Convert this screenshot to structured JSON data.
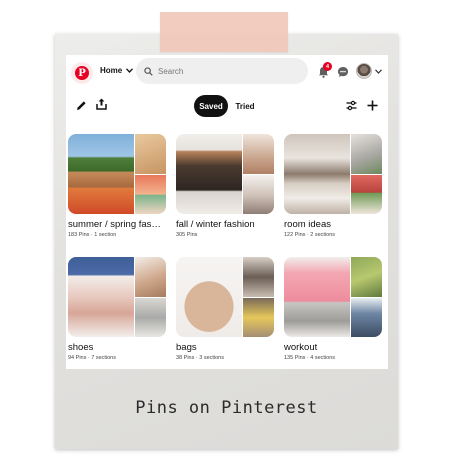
{
  "header": {
    "logo": "pinterest-logo",
    "home_label": "Home",
    "search_placeholder": "Search",
    "notification_count": "4",
    "accent_color": "#e60023"
  },
  "toolbar": {
    "tabs": [
      {
        "label": "Saved",
        "active": true
      },
      {
        "label": "Tried",
        "active": false
      }
    ],
    "icons": [
      "pencil-icon",
      "share-icon",
      "filter-icon",
      "plus-icon"
    ]
  },
  "boards": [
    {
      "title": "summer / spring fashi...",
      "meta": "183 Pins · 1 section"
    },
    {
      "title": "fall / winter fashion",
      "meta": "305 Pins"
    },
    {
      "title": "room ideas",
      "meta": "122 Pins · 2 sections"
    },
    {
      "title": "shoes",
      "meta": "94 Pins · 7 sections"
    },
    {
      "title": "bags",
      "meta": "38 Pins · 3 sections"
    },
    {
      "title": "workout",
      "meta": "135 Pins · 4 sections"
    }
  ],
  "caption": "Pins on Pinterest"
}
